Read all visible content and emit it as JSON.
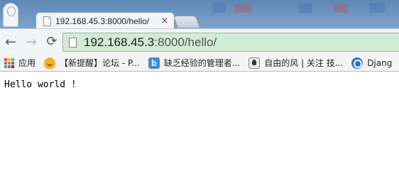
{
  "browser": {
    "tab": {
      "title": "192.168.45.3:8000/hello/",
      "close_glyph": "×"
    },
    "nav": {
      "back_glyph": "←",
      "forward_glyph": "→",
      "reload_glyph": "⟳"
    },
    "address": {
      "host": "192.168.45.3",
      "rest": ":8000/hello/"
    },
    "bookmarks": [
      {
        "label": "应用",
        "icon": "apps-icon"
      },
      {
        "label": "【新提醒】论坛 - P...",
        "icon": "forum-icon"
      },
      {
        "label": "缺乏经验的管理者...",
        "icon": "blog-icon"
      },
      {
        "label": "自由的风 | 关注 技...",
        "icon": "avatar-icon"
      },
      {
        "label": "Djang",
        "icon": "django-icon"
      }
    ],
    "blog_icon_letter": "b"
  },
  "page": {
    "text": "Hello world !"
  },
  "colors": {
    "omnibox_bg": "#d2ebd4",
    "titlebar": "#6b92bf",
    "toolbar": "#f2f4f6",
    "apps_icon_colors": [
      "#e74c3c",
      "#f1c40f",
      "#2ecc71",
      "#3498db",
      "#e67e22",
      "#9b59b6",
      "#1abc9c",
      "#e74c3c",
      "#34495e"
    ]
  }
}
